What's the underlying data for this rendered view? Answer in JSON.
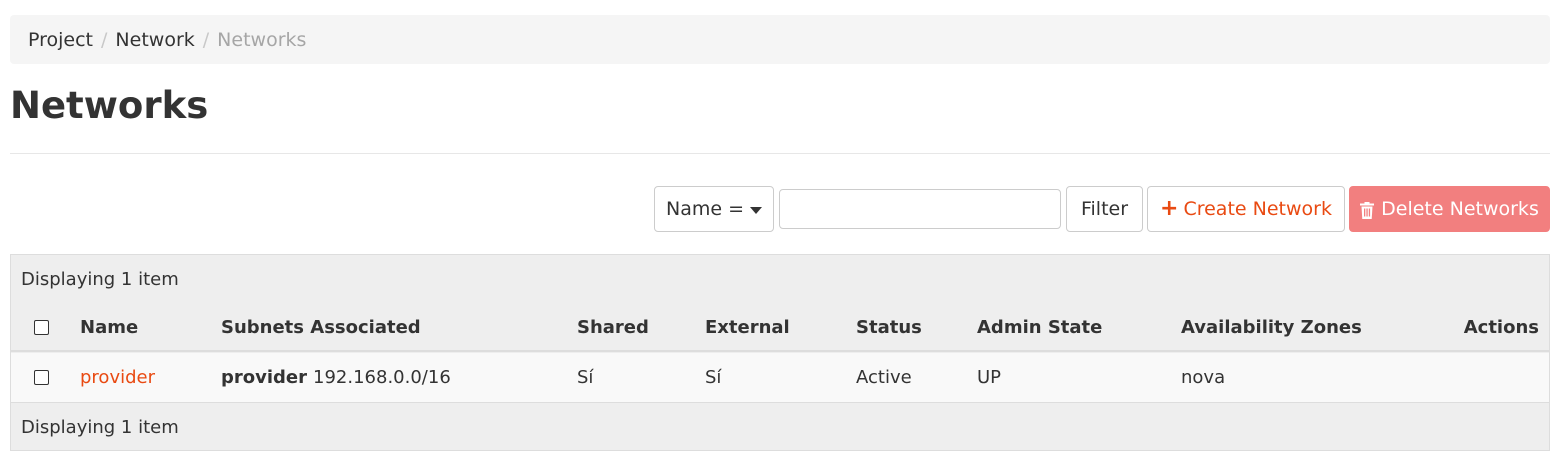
{
  "breadcrumb": {
    "items": [
      "Project",
      "Network",
      "Networks"
    ],
    "separator": "/"
  },
  "page": {
    "title": "Networks"
  },
  "toolbar": {
    "filter_field_label": "Name =",
    "filter_input_value": "",
    "filter_button": "Filter",
    "create_button": "Create Network",
    "create_icon": "plus-icon",
    "delete_button": "Delete Networks",
    "delete_icon": "trash-icon"
  },
  "table": {
    "caption_top": "Displaying 1 item",
    "caption_bottom": "Displaying 1 item",
    "columns": [
      "Name",
      "Subnets Associated",
      "Shared",
      "External",
      "Status",
      "Admin State",
      "Availability Zones",
      "Actions"
    ],
    "rows": [
      {
        "name": "provider",
        "subnet_name": "provider",
        "subnet_cidr": "192.168.0.0/16",
        "shared": "Sí",
        "external": "Sí",
        "status": "Active",
        "admin_state": "UP",
        "availability_zones": "nova",
        "actions": ""
      }
    ]
  },
  "colors": {
    "accent": "#e94a12",
    "danger_disabled": "#f27f7f",
    "breadcrumb_bg": "#f5f5f5",
    "table_bg": "#eeeeee"
  }
}
